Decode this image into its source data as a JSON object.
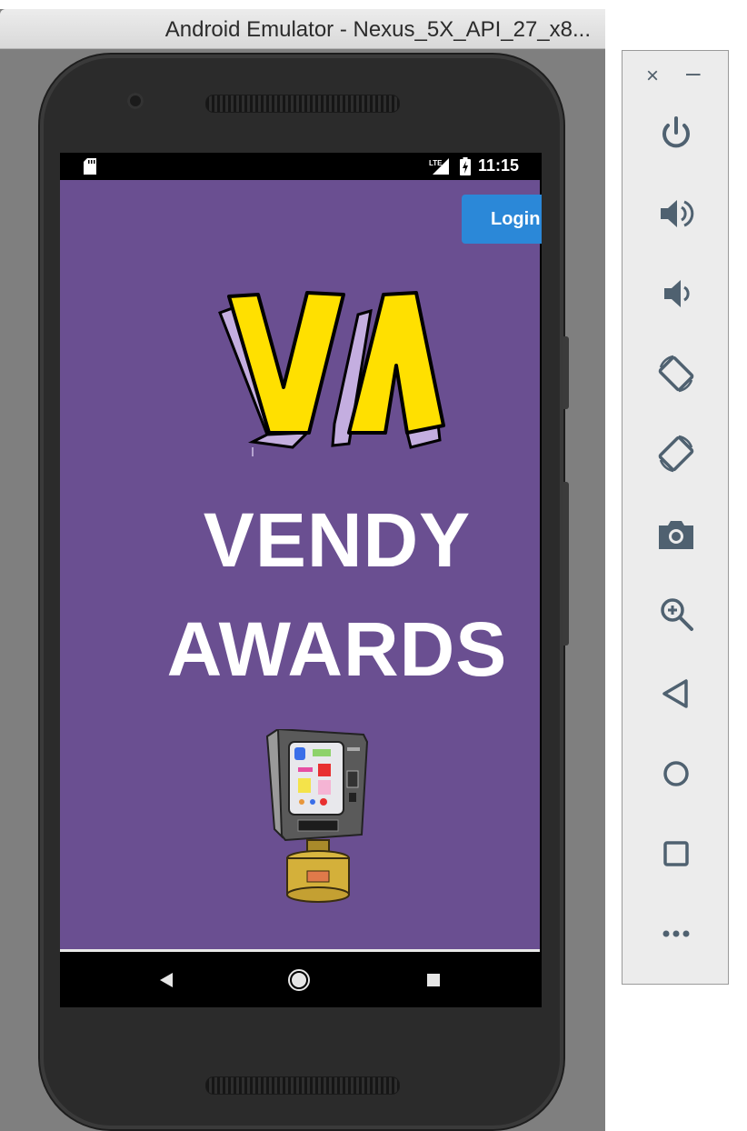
{
  "window": {
    "title": "Android Emulator - Nexus_5X_API_27_x8..."
  },
  "status_bar": {
    "time": "11:15",
    "network": "LTE"
  },
  "app": {
    "login_label": "Login",
    "headline_line1": "VENDY",
    "headline_line2": "AWARDS",
    "logo_text": "VA",
    "background_color": "#6a4f91",
    "login_color": "#2b88d8",
    "logo_yellow": "#ffe000",
    "logo_lilac": "#c4aee0"
  },
  "nav_bar": {
    "buttons": [
      "back-icon",
      "home-icon",
      "recents-icon"
    ]
  },
  "toolbar": {
    "close_glyph": "×",
    "minimize_glyph": "–",
    "buttons": [
      "power-icon",
      "volume-up-icon",
      "volume-down-icon",
      "rotate-left-icon",
      "rotate-right-icon",
      "camera-icon",
      "zoom-icon",
      "back-icon",
      "home-icon",
      "overview-icon",
      "more-icon"
    ],
    "icon_color": "#4f6170"
  }
}
